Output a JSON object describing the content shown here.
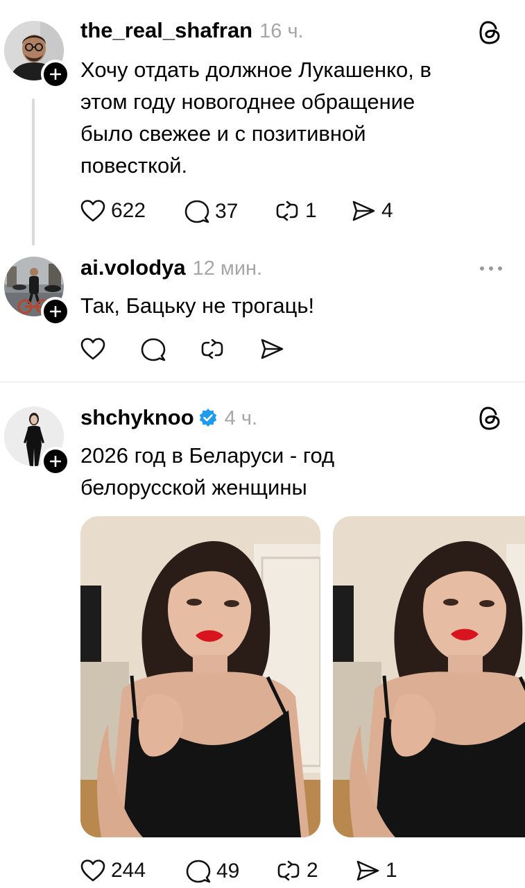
{
  "posts": [
    {
      "username": "the_real_shafran",
      "time": "16 ч.",
      "lines": [
        "Хочу отдать должное Лукашенко, в",
        "этом году новогоднее обращение",
        "было свежее и с позитивной",
        "повесткой."
      ],
      "likes": "622",
      "comments": "37",
      "reposts": "1",
      "shares": "4",
      "avatar_icon": "man-with-glasses-avatar",
      "corner_icon": "threads-logo-icon"
    },
    {
      "username": "ai.volodya",
      "time": "12 мин.",
      "lines": [
        "Так, Бацьку не трогаць!"
      ],
      "avatar_icon": "man-on-bicycle-avatar",
      "corner_icon": "more-options-icon"
    },
    {
      "username": "shchyknoo",
      "time": "4 ч.",
      "verified": true,
      "lines": [
        "2026 год в Беларуси - год",
        "белорусской женщины"
      ],
      "likes": "244",
      "comments": "49",
      "reposts": "2",
      "shares": "1",
      "avatar_icon": "woman-in-black-avatar",
      "corner_icon": "threads-logo-icon"
    }
  ],
  "colors": {
    "text": "#000000",
    "muted": "#a6a6a6",
    "verified": "#1d9bf0",
    "lips": "#d8141e",
    "divider": "#e4e4e4"
  }
}
